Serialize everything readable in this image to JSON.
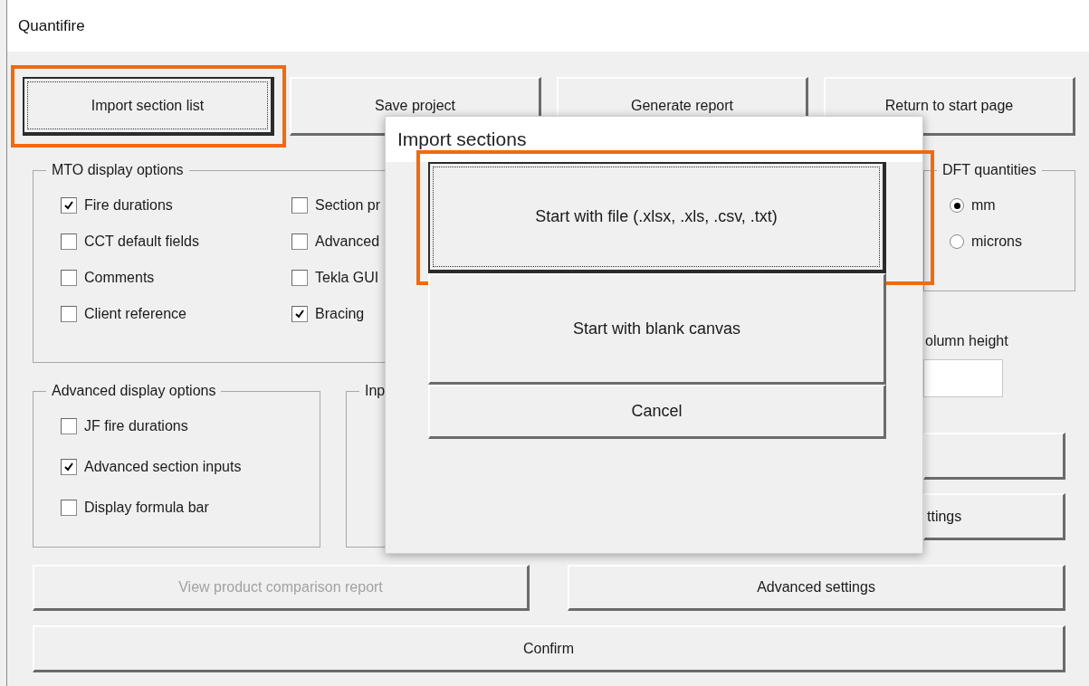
{
  "window": {
    "title": "Quantifire"
  },
  "toolbar": [
    {
      "label": "Import section list",
      "focused": true,
      "highlighted": true
    },
    {
      "label": "Save project",
      "focused": false,
      "highlighted": false
    },
    {
      "label": "Generate report",
      "focused": false,
      "highlighted": false
    },
    {
      "label": "Return to start page",
      "focused": false,
      "highlighted": false
    }
  ],
  "mto_display_options": {
    "title": "MTO display options",
    "columns": [
      [
        {
          "label": "Fire durations",
          "checked": true
        },
        {
          "label": "CCT default fields",
          "checked": false
        },
        {
          "label": "Comments",
          "checked": false
        },
        {
          "label": "Client reference",
          "checked": false
        }
      ],
      [
        {
          "label": "Section pr",
          "checked": false
        },
        {
          "label": "Advanced",
          "checked": false
        },
        {
          "label": "Tekla GUI",
          "checked": false
        },
        {
          "label": "Bracing",
          "checked": true
        }
      ]
    ]
  },
  "dft_quantities": {
    "title": "DFT quantities",
    "options": [
      {
        "label": "mm",
        "selected": true
      },
      {
        "label": "microns",
        "selected": false
      }
    ]
  },
  "column_height": {
    "label": "olumn height"
  },
  "side_buttons": [
    {
      "kind": "plain"
    },
    {
      "label": "ttings",
      "disabled": false
    }
  ],
  "advanced_display_options": {
    "title": "Advanced display options",
    "options": [
      {
        "label": "JF fire durations",
        "checked": false
      },
      {
        "label": "Advanced section inputs",
        "checked": true
      },
      {
        "label": "Display formula bar",
        "checked": false
      }
    ]
  },
  "input_frame": {
    "title": "Inp"
  },
  "bottom_buttons": [
    {
      "label": "View product comparison report",
      "disabled": true
    },
    {
      "label": "Advanced settings",
      "disabled": false
    }
  ],
  "confirm": {
    "label": "Confirm"
  },
  "dialog": {
    "title": "Import sections",
    "buttons": [
      {
        "label": "Start with file (.xlsx, .xls, .csv, .txt)",
        "focused": true,
        "highlighted": true,
        "kind": "large"
      },
      {
        "label": "Start with blank canvas",
        "focused": false,
        "highlighted": false,
        "kind": "large"
      },
      {
        "label": "Cancel",
        "focused": false,
        "highlighted": false,
        "kind": "small"
      }
    ]
  }
}
